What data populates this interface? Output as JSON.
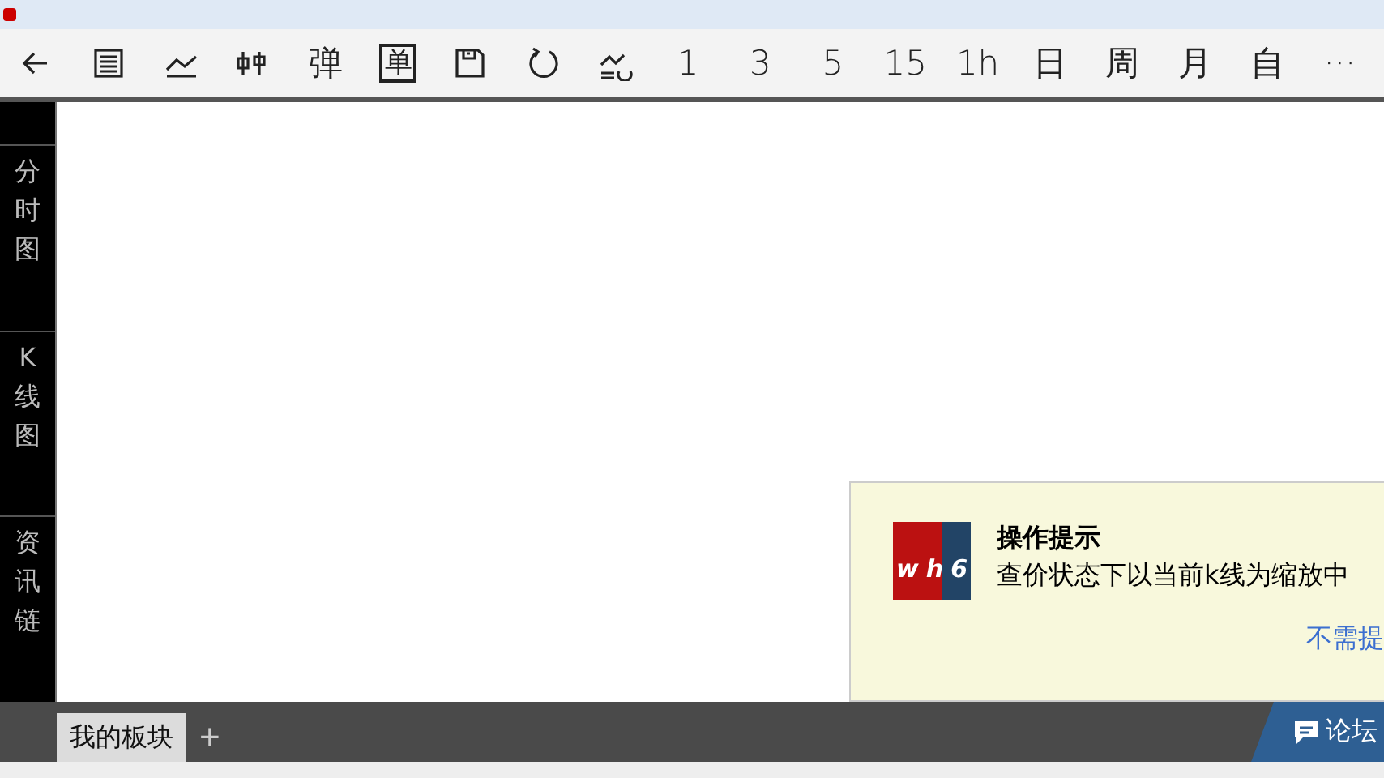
{
  "toolbar": {
    "items": [
      {
        "kind": "back"
      },
      {
        "kind": "list"
      },
      {
        "kind": "line"
      },
      {
        "kind": "candle"
      },
      {
        "kind": "glyph",
        "label": "弹"
      },
      {
        "kind": "boxed",
        "label": "单"
      },
      {
        "kind": "save"
      },
      {
        "kind": "refresh"
      },
      {
        "kind": "trend"
      },
      {
        "kind": "text",
        "label": "1"
      },
      {
        "kind": "text",
        "label": "3"
      },
      {
        "kind": "text",
        "label": "5"
      },
      {
        "kind": "text",
        "label": "15"
      },
      {
        "kind": "text",
        "label": "1h"
      },
      {
        "kind": "text",
        "label": "日"
      },
      {
        "kind": "text",
        "label": "周"
      },
      {
        "kind": "text",
        "label": "月"
      },
      {
        "kind": "text",
        "label": "自"
      },
      {
        "kind": "text",
        "label": "···"
      }
    ]
  },
  "sidebar": {
    "tabs": [
      {
        "label": "分时图"
      },
      {
        "label": "K线图"
      },
      {
        "label": "资讯链"
      }
    ]
  },
  "popup": {
    "logo_text": "wh6",
    "title": "操作提示",
    "message": "查价状态下以当前k线为缩放中",
    "link": "不需提"
  },
  "bottom_bar": {
    "tabs": [
      {
        "label": "我的板块",
        "selected": true
      }
    ],
    "add": "+",
    "forum": "论坛"
  }
}
